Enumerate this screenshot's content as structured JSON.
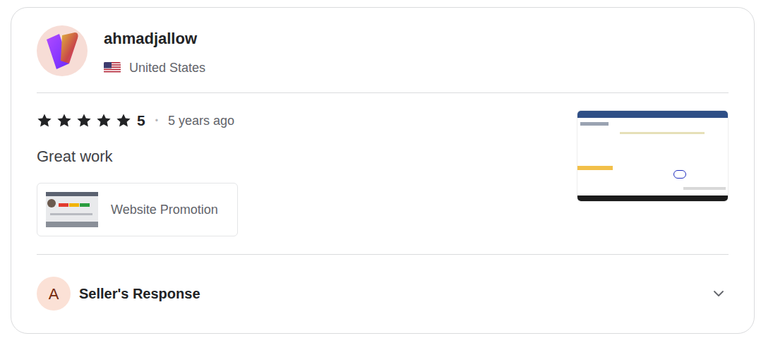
{
  "user": {
    "name": "ahmadjallow",
    "country": "United States"
  },
  "review": {
    "stars": 5,
    "rating": "5",
    "separator": "•",
    "time": "5 years ago",
    "text": "Great work"
  },
  "gig": {
    "title": "Website Promotion"
  },
  "seller_response": {
    "avatar": "A",
    "label": "Seller's Response",
    "expanded": false
  }
}
